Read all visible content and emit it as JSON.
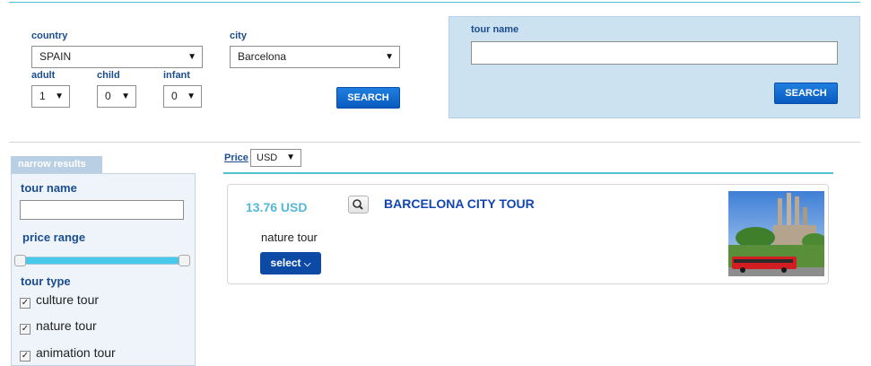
{
  "search": {
    "country_label": "country",
    "country_value": "SPAIN",
    "city_label": "city",
    "city_value": "Barcelona",
    "adult_label": "adult",
    "adult_value": "1",
    "child_label": "child",
    "child_value": "0",
    "infant_label": "infant",
    "infant_value": "0",
    "search_label": "SEARCH"
  },
  "tour_search": {
    "label": "tour name",
    "value": "",
    "search_label": "SEARCH"
  },
  "filters": {
    "tab_label": "narrow results",
    "tour_name_label": "tour name",
    "tour_name_value": "",
    "price_range_label": "price range",
    "price_range_min_fraction": 0,
    "price_range_max_fraction": 1,
    "tour_type_label": "tour type",
    "tour_types": [
      {
        "label": "culture tour",
        "checked": true
      },
      {
        "label": "nature tour",
        "checked": true
      },
      {
        "label": "animation tour",
        "checked": true
      }
    ]
  },
  "results": {
    "price_label": "Price",
    "currency_value": "USD",
    "items": [
      {
        "price": "13.76 USD",
        "title": "BARCELONA CITY TOUR",
        "type": "nature tour",
        "select_label": "select"
      }
    ]
  },
  "colors": {
    "accent": "#4cc3cf",
    "button": "#0a5bbf",
    "label": "#1a4d8f",
    "price": "#55b7d9",
    "title": "#1146b3"
  },
  "icons": {
    "dropdown": "dropdown-arrow-icon",
    "magnifier": "search-icon",
    "checkbox": "checkbox-checked-icon",
    "chevron": "chevron-down-icon"
  }
}
